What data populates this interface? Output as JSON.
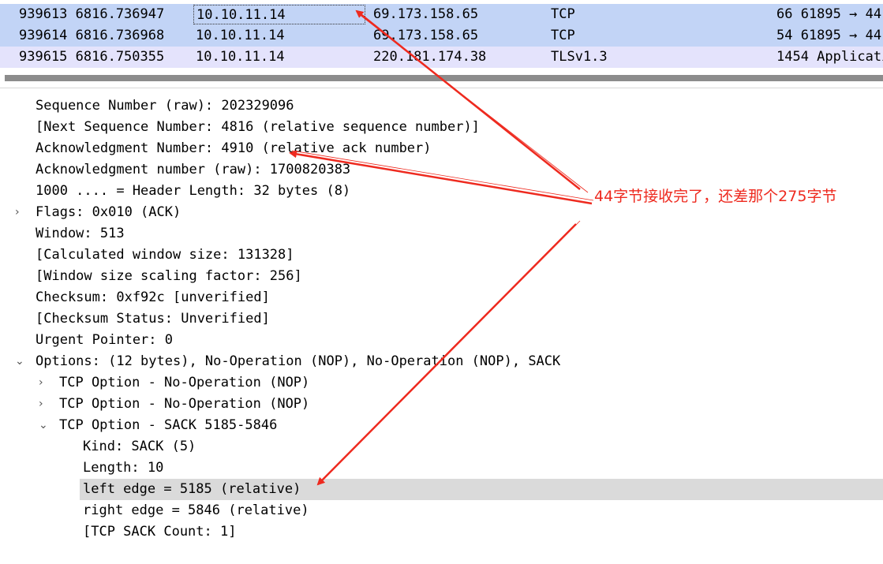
{
  "packets": [
    {
      "no_time": "939613 6816.736947",
      "source": "10.10.11.14",
      "destination": "69.173.158.65",
      "protocol": "TCP",
      "info": "66 61895 → 44"
    },
    {
      "no_time": "939614 6816.736968",
      "source": "10.10.11.14",
      "destination": "69.173.158.65",
      "protocol": "TCP",
      "info": "54 61895 → 44"
    },
    {
      "no_time": "939615 6816.750355",
      "source": "10.10.11.14",
      "destination": "220.181.174.38",
      "protocol": "TLSv1.3",
      "info": "1454 Applicatio"
    }
  ],
  "details": [
    {
      "text": "Sequence Number (raw): 202329096"
    },
    {
      "text": "[Next Sequence Number: 4816    (relative sequence number)]"
    },
    {
      "text": "Acknowledgment Number: 4910    (relative ack number)"
    },
    {
      "text": "Acknowledgment number (raw): 1700820383"
    },
    {
      "text": "1000 .... = Header Length: 32 bytes (8)"
    },
    {
      "text": "Flags: 0x010 (ACK)",
      "arrow": "›"
    },
    {
      "text": "Window: 513"
    },
    {
      "text": "[Calculated window size: 131328]"
    },
    {
      "text": "[Window size scaling factor: 256]"
    },
    {
      "text": "Checksum: 0xf92c [unverified]"
    },
    {
      "text": "[Checksum Status: Unverified]"
    },
    {
      "text": "Urgent Pointer: 0"
    },
    {
      "text": "Options: (12 bytes), No-Operation (NOP), No-Operation (NOP), SACK",
      "arrow": "⌄"
    },
    {
      "text": "TCP Option - No-Operation (NOP)",
      "arrow": "›"
    },
    {
      "text": "TCP Option - No-Operation (NOP)",
      "arrow": "›"
    },
    {
      "text": "TCP Option - SACK 5185-5846",
      "arrow": "⌄"
    },
    {
      "text": "Kind: SACK (5)"
    },
    {
      "text": "Length: 10"
    },
    {
      "text": "left edge = 5185 (relative)"
    },
    {
      "text": "right edge = 5846 (relative)"
    },
    {
      "text": "[TCP SACK Count: 1]"
    }
  ],
  "annotation": {
    "text": "44字节接收完了，还差那个275字节",
    "color": "#ee2a1f"
  },
  "colors": {
    "selected_row": "#c2d4f6",
    "tls_row": "#e4e3fc",
    "highlighted_detail": "#dadada"
  }
}
